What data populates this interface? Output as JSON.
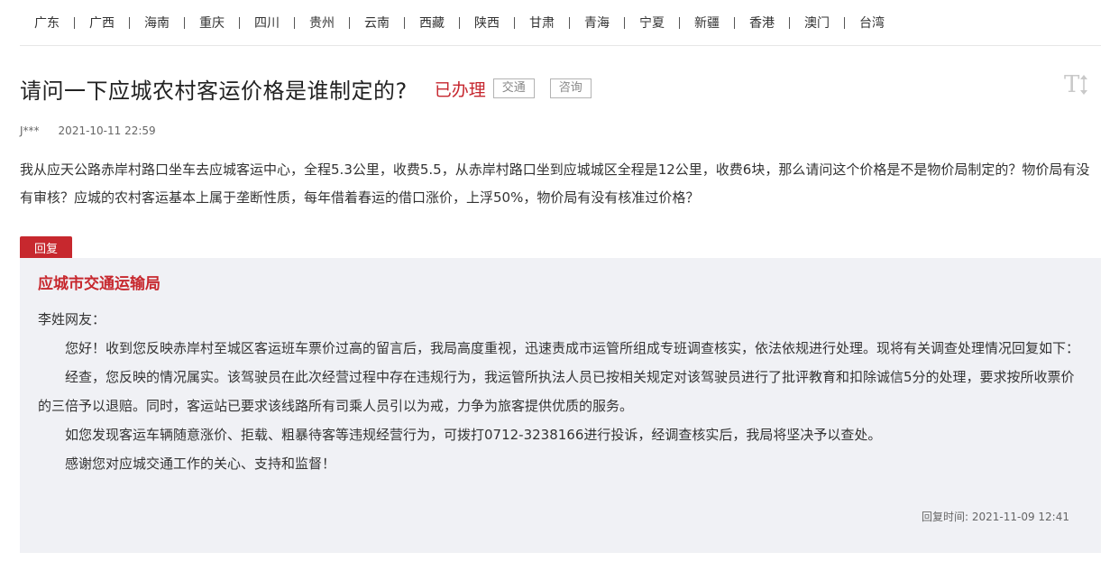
{
  "regions": [
    "广东",
    "广西",
    "海南",
    "重庆",
    "四川",
    "贵州",
    "云南",
    "西藏",
    "陕西",
    "甘肃",
    "青海",
    "宁夏",
    "新疆",
    "香港",
    "澳门",
    "台湾"
  ],
  "post": {
    "title": "请问一下应城农村客运价格是谁制定的?",
    "status": "已办理",
    "tags": [
      "交通",
      "咨询"
    ],
    "font_toggle_icon": "T-resize-icon",
    "author": "J***",
    "date": "2021-10-11 22:59",
    "question": "我从应天公路赤岸村路口坐车去应城客运中心，全程5.3公里，收费5.5，从赤岸村路口坐到应城城区全程是12公里，收费6块，那么请问这个价格是不是物价局制定的？物价局有没有审核？应城的农村客运基本上属于垄断性质，每年借着春运的借口涨价，上浮50%，物价局有没有核准过价格？"
  },
  "reply": {
    "label": "回复",
    "org": "应城市交通运输局",
    "salutation": "李姓网友：",
    "paragraphs": [
      "您好！收到您反映赤岸村至城区客运班车票价过高的留言后，我局高度重视，迅速责成市运管所组成专班调查核实，依法依规进行处理。现将有关调查处理情况回复如下：",
      "经查，您反映的情况属实。该驾驶员在此次经营过程中存在违规行为，我运管所执法人员已按相关规定对该驾驶员进行了批评教育和扣除诚信5分的处理，要求按所收票价的三倍予以退赔。同时，客运站已要求该线路所有司乘人员引以为戒，力争为旅客提供优质的服务。",
      "如您发现客运车辆随意涨价、拒载、粗暴待客等违规经营行为，可拨打0712-3238166进行投诉，经调查核实后，我局将坚决予以查处。",
      "感谢您对应城交通工作的关心、支持和监督！"
    ],
    "time_label": "回复时间:",
    "time": "2021-11-09 12:41"
  },
  "colors": {
    "accent": "#c7282e",
    "reply_bg": "#f0f1f5",
    "tag_border": "#b3b3b3"
  }
}
